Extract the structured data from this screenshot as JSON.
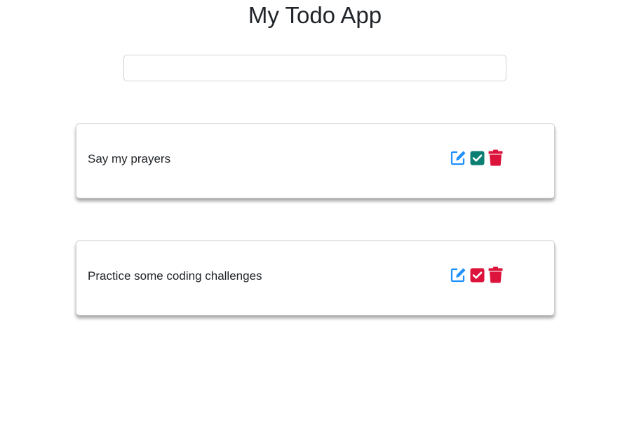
{
  "app": {
    "title": "My Todo App"
  },
  "new_todo": {
    "value": "",
    "placeholder": ""
  },
  "todos": [
    {
      "text": "Say my prayers",
      "check_color": "#0b7f73"
    },
    {
      "text": "Practice some coding challenges",
      "check_color": "#dc143c"
    }
  ],
  "icons": {
    "edit": "edit-icon",
    "check": "check-square-icon",
    "trash": "trash-icon"
  },
  "colors": {
    "edit": "#1e90ff",
    "delete": "#dc143c"
  }
}
